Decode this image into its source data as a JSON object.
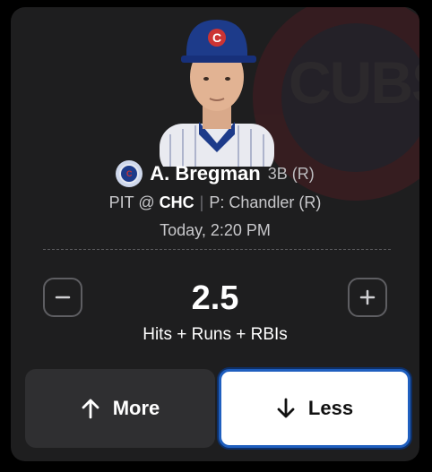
{
  "player": {
    "name": "A. Bregman",
    "position": "3B (R)",
    "team_badge_text": "C",
    "bg_logo_text": "CUBS"
  },
  "matchup": {
    "away": "PIT",
    "at": "@",
    "home": "CHC",
    "separator": "|",
    "pitcher": "P: Chandler  (R)"
  },
  "game_time": "Today, 2:20 PM",
  "line": {
    "value": "2.5",
    "stat_type": "Hits + Runs + RBIs"
  },
  "buttons": {
    "more_label": "More",
    "less_label": "Less"
  },
  "icons": {
    "decrease": "minus-icon",
    "increase": "plus-icon",
    "more": "arrow-up-icon",
    "less": "arrow-down-icon"
  },
  "colors": {
    "card_bg": "#1e1e1f",
    "selected_border": "#1f5fbf",
    "cubs_blue": "#1d3b8a",
    "cubs_red": "#cc3433"
  }
}
